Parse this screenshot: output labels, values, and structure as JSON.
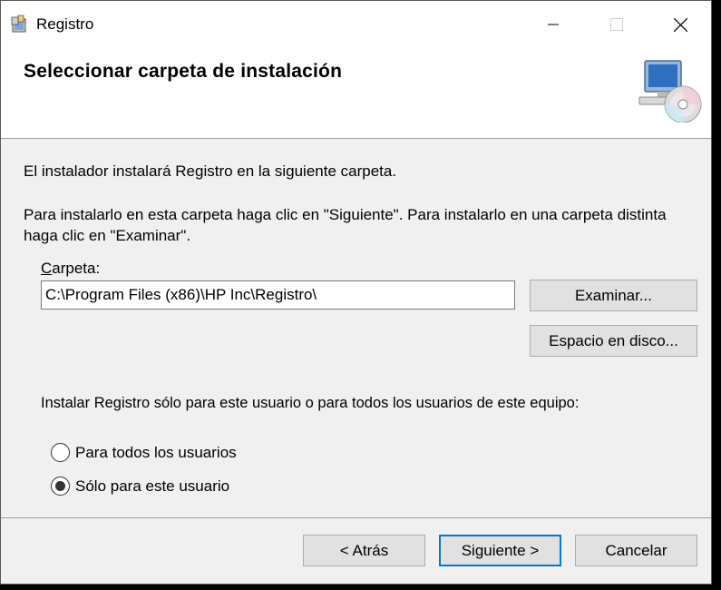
{
  "window": {
    "title": "Registro"
  },
  "header": {
    "title": "Seleccionar carpeta de instalación",
    "icon": "computer-cd-icon"
  },
  "body": {
    "intro": "El instalador instalará Registro en la siguiente carpeta.",
    "instructions": "Para instalarlo en esta carpeta haga clic en \"Siguiente\". Para instalarlo en una carpeta distinta haga clic en \"Examinar\".",
    "folder_label_accel": "C",
    "folder_label_rest": "arpeta:",
    "folder_path": "C:\\Program Files (x86)\\HP Inc\\Registro\\",
    "browse_label": "Examinar...",
    "disk_space_label": "Espacio en disco...",
    "scope_question": "Instalar Registro sólo para este usuario o para todos los usuarios de este equipo:",
    "options": [
      {
        "label": "Para todos los usuarios",
        "selected": false
      },
      {
        "label": "Sólo para este usuario",
        "selected": true
      }
    ]
  },
  "footer": {
    "back_label": "< Atrás",
    "next_label": "Siguiente >",
    "cancel_label": "Cancelar"
  },
  "colors": {
    "focus_border": "#0078d7",
    "dialog_bg": "#f0f0f0"
  }
}
